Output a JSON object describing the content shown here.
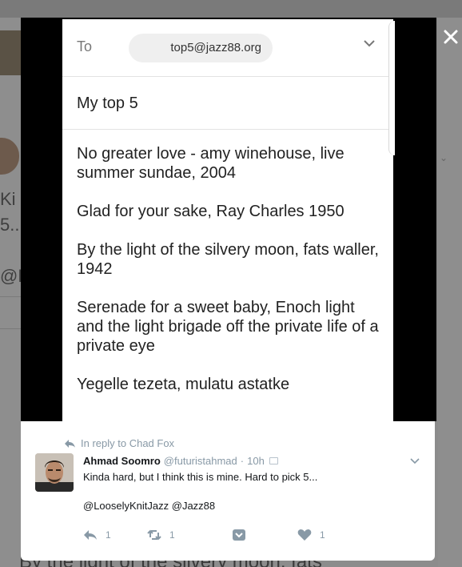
{
  "email": {
    "to_label": "To",
    "recipient": "top5@jazz88.org",
    "subject": "My top 5",
    "body": [
      "No greater love - amy winehouse, live summer sundae, 2004",
      "Glad for your sake, Ray Charles 1950",
      "By the light of the silvery moon, fats waller, 1942",
      "Serenade for a sweet baby, Enoch light and the light brigade off the private life of a private eye",
      "Yegelle tezeta, mulatu astatke"
    ]
  },
  "tweet": {
    "reply_to": "In reply to Chad Fox",
    "author_name": "Ahmad Soomro",
    "author_handle": "@futuristahmad",
    "separator": "·",
    "time": "10h",
    "text": "Kinda hard, but I think this is mine. Hard to pick 5...",
    "mentions": "@LooselyKnitJazz @Jazz88",
    "reply_count": "1",
    "retweet_count": "1",
    "like_count": "1"
  },
  "background": {
    "partial_text_1": "Ki",
    "partial_text_2": "5..",
    "partial_text_3": "@L",
    "bottom_text": "By the light of the silvery moon, fats"
  },
  "colors": {
    "twitter_grey": "#8899a6",
    "text_dark": "#14171a",
    "chip_bg": "#efefef"
  },
  "icons": {
    "close": "close-icon",
    "chevron": "chevron-down-icon",
    "reply": "reply-icon",
    "retweet": "retweet-icon",
    "dm": "direct-message-icon",
    "like": "heart-icon"
  }
}
